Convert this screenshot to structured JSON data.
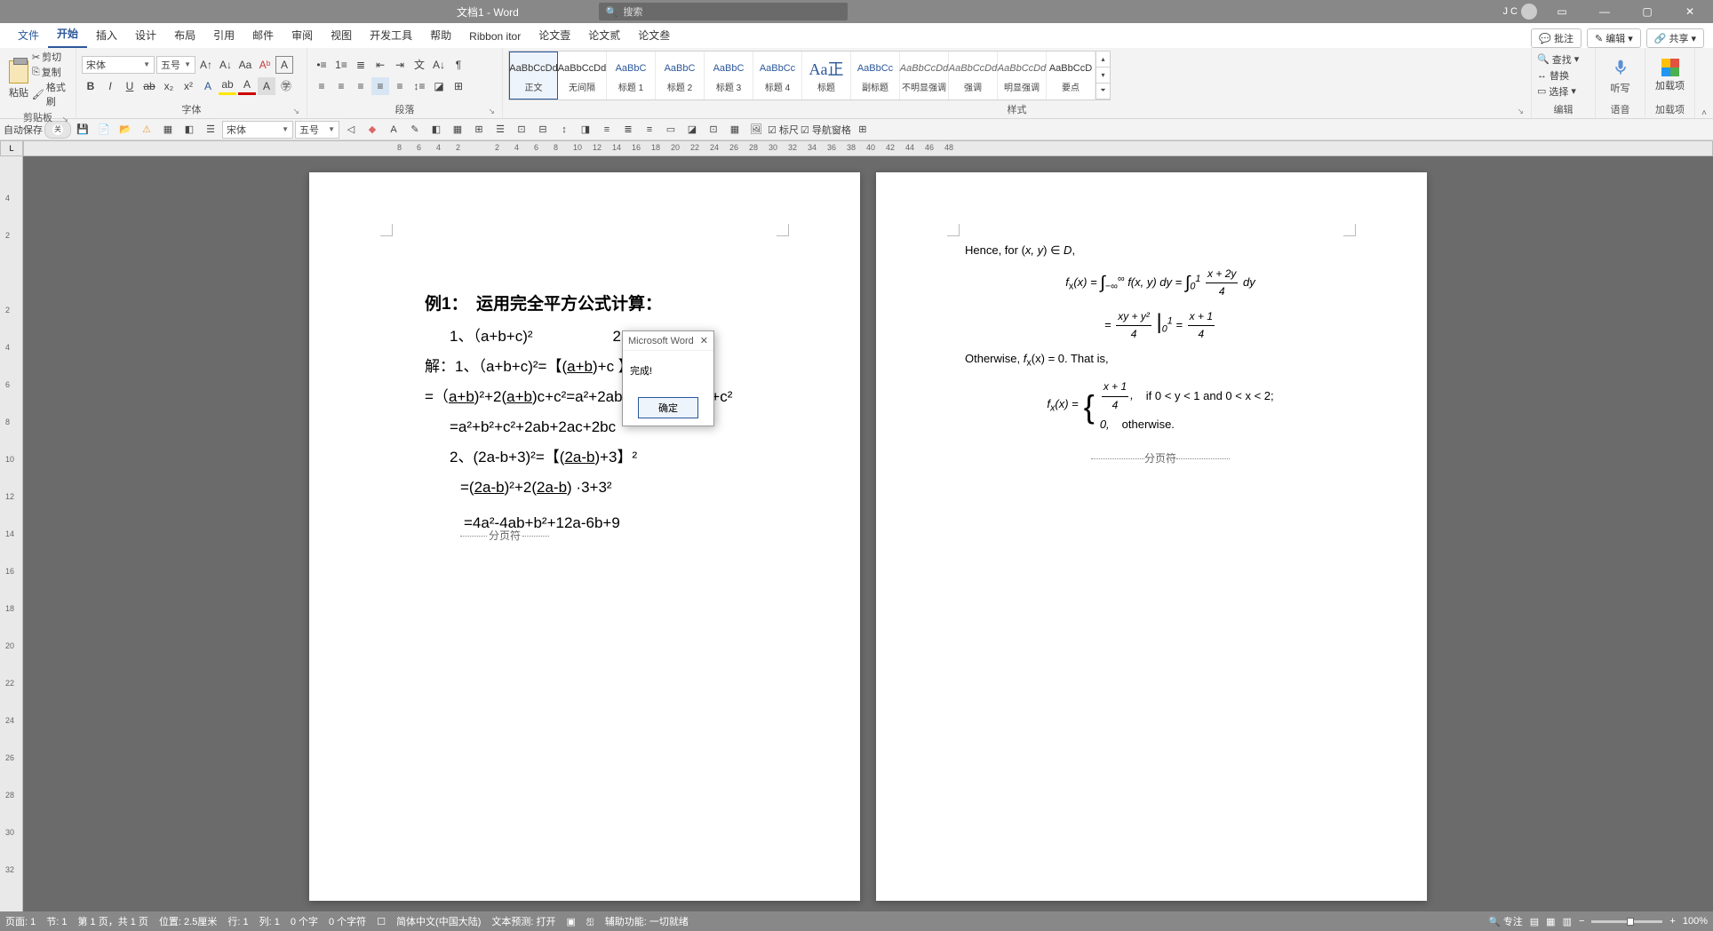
{
  "titlebar": {
    "title": "文档1 - Word",
    "search_placeholder": "搜索",
    "user_initials": "J C"
  },
  "menu": {
    "tabs": [
      "文件",
      "开始",
      "插入",
      "设计",
      "布局",
      "引用",
      "邮件",
      "审阅",
      "视图",
      "开发工具",
      "帮助",
      "Ribbon itor",
      "论文壹",
      "论文贰",
      "论文叁"
    ],
    "active_index": 1,
    "comments_btn": "批注",
    "edit_btn": "编辑",
    "share_btn": "共享"
  },
  "ribbon": {
    "clipboard": {
      "paste": "粘贴",
      "cut": "剪切",
      "copy": "复制",
      "painter": "格式刷",
      "label": "剪贴板"
    },
    "font": {
      "name": "宋体",
      "size": "五号",
      "label": "字体"
    },
    "paragraph": {
      "label": "段落"
    },
    "styles": {
      "label": "样式",
      "items": [
        {
          "preview": "AaBbCcDd",
          "class": "",
          "label": "正文",
          "selected": true
        },
        {
          "preview": "AaBbCcDd",
          "class": "",
          "label": "无间隔"
        },
        {
          "preview": "AaBbC",
          "class": "blue",
          "label": "标题 1"
        },
        {
          "preview": "AaBbC",
          "class": "blue",
          "label": "标题 2"
        },
        {
          "preview": "AaBbC",
          "class": "blue",
          "label": "标题 3"
        },
        {
          "preview": "AaBbCc",
          "class": "blue",
          "label": "标题 4"
        },
        {
          "preview": "Aa正",
          "class": "headline",
          "label": "标题"
        },
        {
          "preview": "AaBbCc",
          "class": "blue",
          "label": "副标题"
        },
        {
          "preview": "AaBbCcDd",
          "class": "italic",
          "label": "不明显强调"
        },
        {
          "preview": "AaBbCcDd",
          "class": "italic",
          "label": "强调"
        },
        {
          "preview": "AaBbCcDd",
          "class": "italic",
          "label": "明显强调"
        },
        {
          "preview": "AaBbCcD",
          "class": "",
          "label": "要点"
        }
      ]
    },
    "edit": {
      "find": "查找",
      "replace": "替换",
      "select": "选择",
      "label": "编辑"
    },
    "voice": {
      "dictate": "听写",
      "label": "语音"
    },
    "addons": {
      "addons": "加载项",
      "label": "加载项"
    }
  },
  "qat": {
    "autosave_label": "自动保存",
    "autosave_state": "关",
    "font_name": "宋体",
    "font_size": "五号",
    "ruler_label": "标尺",
    "navpane_label": "导航窗格"
  },
  "ruler_marks": [
    "8",
    "6",
    "4",
    "2",
    "",
    "2",
    "4",
    "6",
    "8",
    "10",
    "12",
    "14",
    "16",
    "18",
    "20",
    "22",
    "24",
    "26",
    "28",
    "30",
    "32",
    "34",
    "36",
    "38",
    "40",
    "42",
    "44",
    "46",
    "48"
  ],
  "vruler_marks": [
    "",
    "4",
    "2",
    "",
    "2",
    "4",
    "6",
    "8",
    "10",
    "12",
    "14",
    "16",
    "18",
    "20",
    "22",
    "24",
    "26",
    "28",
    "30",
    "32"
  ],
  "page1": {
    "title_num": "例1：",
    "title_rest": "运用完全平方公式计算：",
    "l1a": "1、（a+b+c)²",
    "l1b": "2、(2a-b+3)²",
    "l2_pre": "解：1、（a+b+c)²=【(",
    "l2_u": "a+b",
    "l2_post": ")+c 】²",
    "l3_pre": "=（",
    "l3_u1": "a+b",
    "l3_mid": ")²+2(",
    "l3_u2": "a+b",
    "l3_post": ")c+c²=a²+2ab+b²+2ac+2bc+c²",
    "l4": "=a²+b²+c²+2ab+2ac+2bc",
    "l5_pre": "2、(2a-b+3)²=【(",
    "l5_u": "2a-b",
    "l5_post": ")+3】²",
    "l6_pre": "=(",
    "l6_u1": "2a-b",
    "l6_mid": ")²+2(",
    "l6_u2": "2a-b",
    "l6_post": ") ·3+3²",
    "l7": "=4a²-4ab+b²+12a-6b+9",
    "divider": "分页符"
  },
  "page2": {
    "line1_a": "Hence, for (",
    "line1_i": "x, y",
    "line1_b": ") ∈ ",
    "line1_c": "D",
    "line1_d": ",",
    "eq1_lhs": "f",
    "eq1_sub": "x",
    "eq1_arg": "(x) = ",
    "eq1_int1_lo": "−∞",
    "eq1_int1_hi": "∞",
    "eq1_fn": " f(x, y) dy = ",
    "eq1_int2_lo": "0",
    "eq1_int2_hi": "1",
    "eq1_frac_num": "x + 2y",
    "eq1_frac_den": "4",
    "eq1_dy": " dy",
    "eq2_pre": "= ",
    "eq2_frac1_num": "xy + y²",
    "eq2_frac1_den": "4",
    "eq2_bar_lo": "0",
    "eq2_bar_hi": "1",
    "eq2_eq": " = ",
    "eq2_frac2_num": "x + 1",
    "eq2_frac2_den": "4",
    "line3_a": "Otherwise, ",
    "line3_f": "f",
    "line3_sub": "x",
    "line3_b": "(x) = 0.  That is,",
    "case_lhs_f": "f",
    "case_lhs_sub": "x",
    "case_lhs_rest": "(x) = ",
    "case1_num": "x + 1",
    "case1_den": "4",
    "case1_comma": ",",
    "case1_cond": "if 0 < y < 1 and 0 < x < 2;",
    "case2_val": "0,",
    "case2_cond": "otherwise.",
    "divider": "分页符"
  },
  "dialog": {
    "title": "Microsoft Word",
    "body": "完成!",
    "ok": "确定"
  },
  "statusbar": {
    "page": "页面: 1",
    "section": "节: 1",
    "pages": "第 1 页，共 1 页",
    "position": "位置: 2.5厘米",
    "line": "行: 1",
    "col": "列: 1",
    "words": "0 个字",
    "chars": "0 个字符",
    "lang": "简体中文(中国大陆)",
    "predict": "文本预测: 打开",
    "access": "辅助功能: 一切就绪",
    "focus": "专注",
    "zoom": "100%"
  }
}
